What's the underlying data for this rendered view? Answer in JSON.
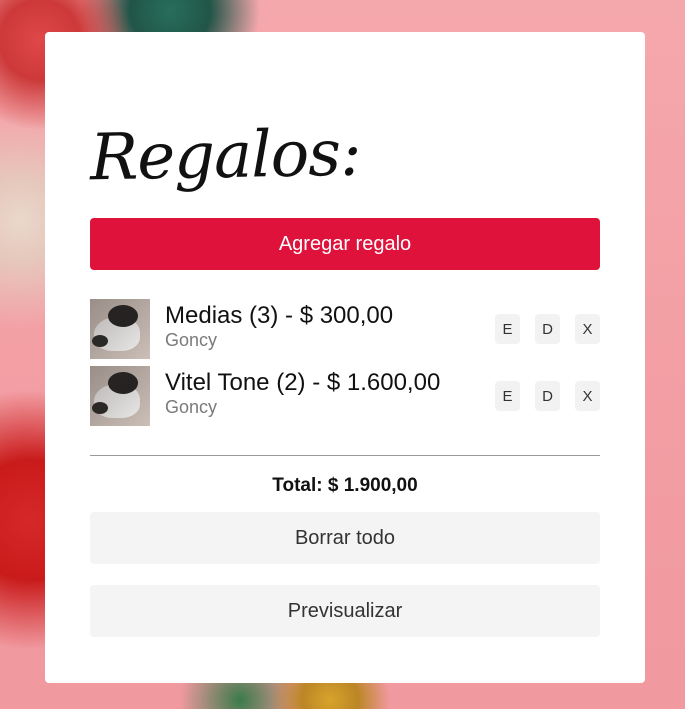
{
  "card": {
    "title": "Regalos:",
    "add_button_label": "Agregar regalo",
    "accent_color": "#df123c"
  },
  "gifts": [
    {
      "name": "Medias (3) - $ 300,00",
      "recipient": "Goncy",
      "thumbnail_icon": "cat-photo",
      "actions": [
        "E",
        "D",
        "X"
      ]
    },
    {
      "name": "Vitel Tone (2) - $ 1.600,00",
      "recipient": "Goncy",
      "thumbnail_icon": "cat-photo",
      "actions": [
        "E",
        "D",
        "X"
      ]
    }
  ],
  "total_label": "Total: $ 1.900,00",
  "buttons": {
    "clear_all": "Borrar todo",
    "preview": "Previsualizar"
  }
}
